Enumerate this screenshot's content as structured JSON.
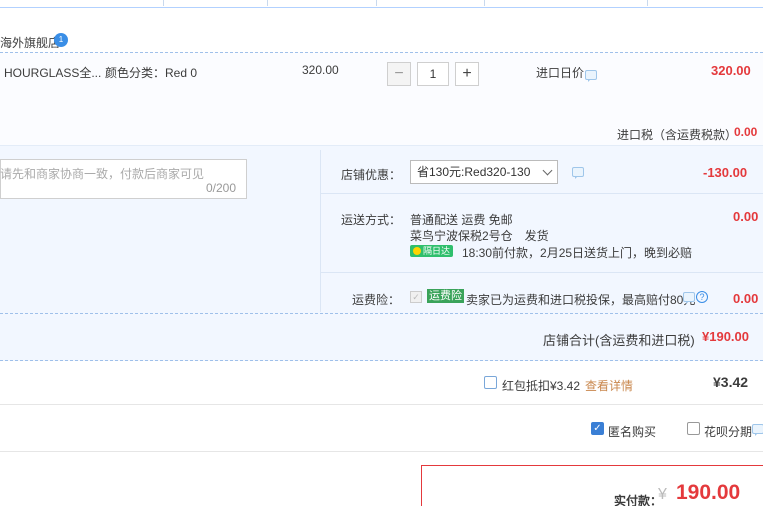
{
  "store": {
    "name": "海外旗舰店",
    "badge": "1"
  },
  "item": {
    "name": "HOURGLASS全...",
    "attr": "颜色分类：Red 0",
    "unit_price": "320.00",
    "quantity": "1",
    "minus_label": "−",
    "plus_label": "+",
    "import_price_label": "进口日价",
    "subtotal": "320.00"
  },
  "tax": {
    "label": "进口税（含运费税款）",
    "value": "0.00"
  },
  "note": {
    "placeholder": "请先和商家协商一致，付款后商家可见",
    "count": "0/200"
  },
  "coupon": {
    "label": "店铺优惠：",
    "selected": "省130元:Red320-130",
    "value": "-130.00"
  },
  "shipping": {
    "label": "运送方式：",
    "line1": "普通配送 运费 免邮",
    "line2": "菜鸟宁波保税2号仓　发货",
    "badge": "隔日达",
    "line3": "18:30前付款，2月25日送货上门，晚到必赔",
    "value": "0.00"
  },
  "insurance": {
    "label": "运费险：",
    "tag": "运费险",
    "desc": "卖家已为运费和进口税投保，最高赔付80元",
    "help": "?",
    "value": "0.00"
  },
  "store_total": {
    "label": "店铺合计(含运费和进口税)",
    "value": "¥190.00"
  },
  "redpacket": {
    "label": "红包抵扣¥3.42",
    "link": "查看详情",
    "value": "¥3.42"
  },
  "options": {
    "anonymous": "匿名购买",
    "huabei": "花呗分期",
    "check_mark": "✓"
  },
  "payment": {
    "label": "实付款：",
    "yen": "¥",
    "amount": "190.00"
  },
  "colors": {
    "accent_red": "#e4393c",
    "accent_blue": "#3a7fd5",
    "insurance_green": "#3aa35a",
    "fast_green": "#2fbf6d"
  }
}
